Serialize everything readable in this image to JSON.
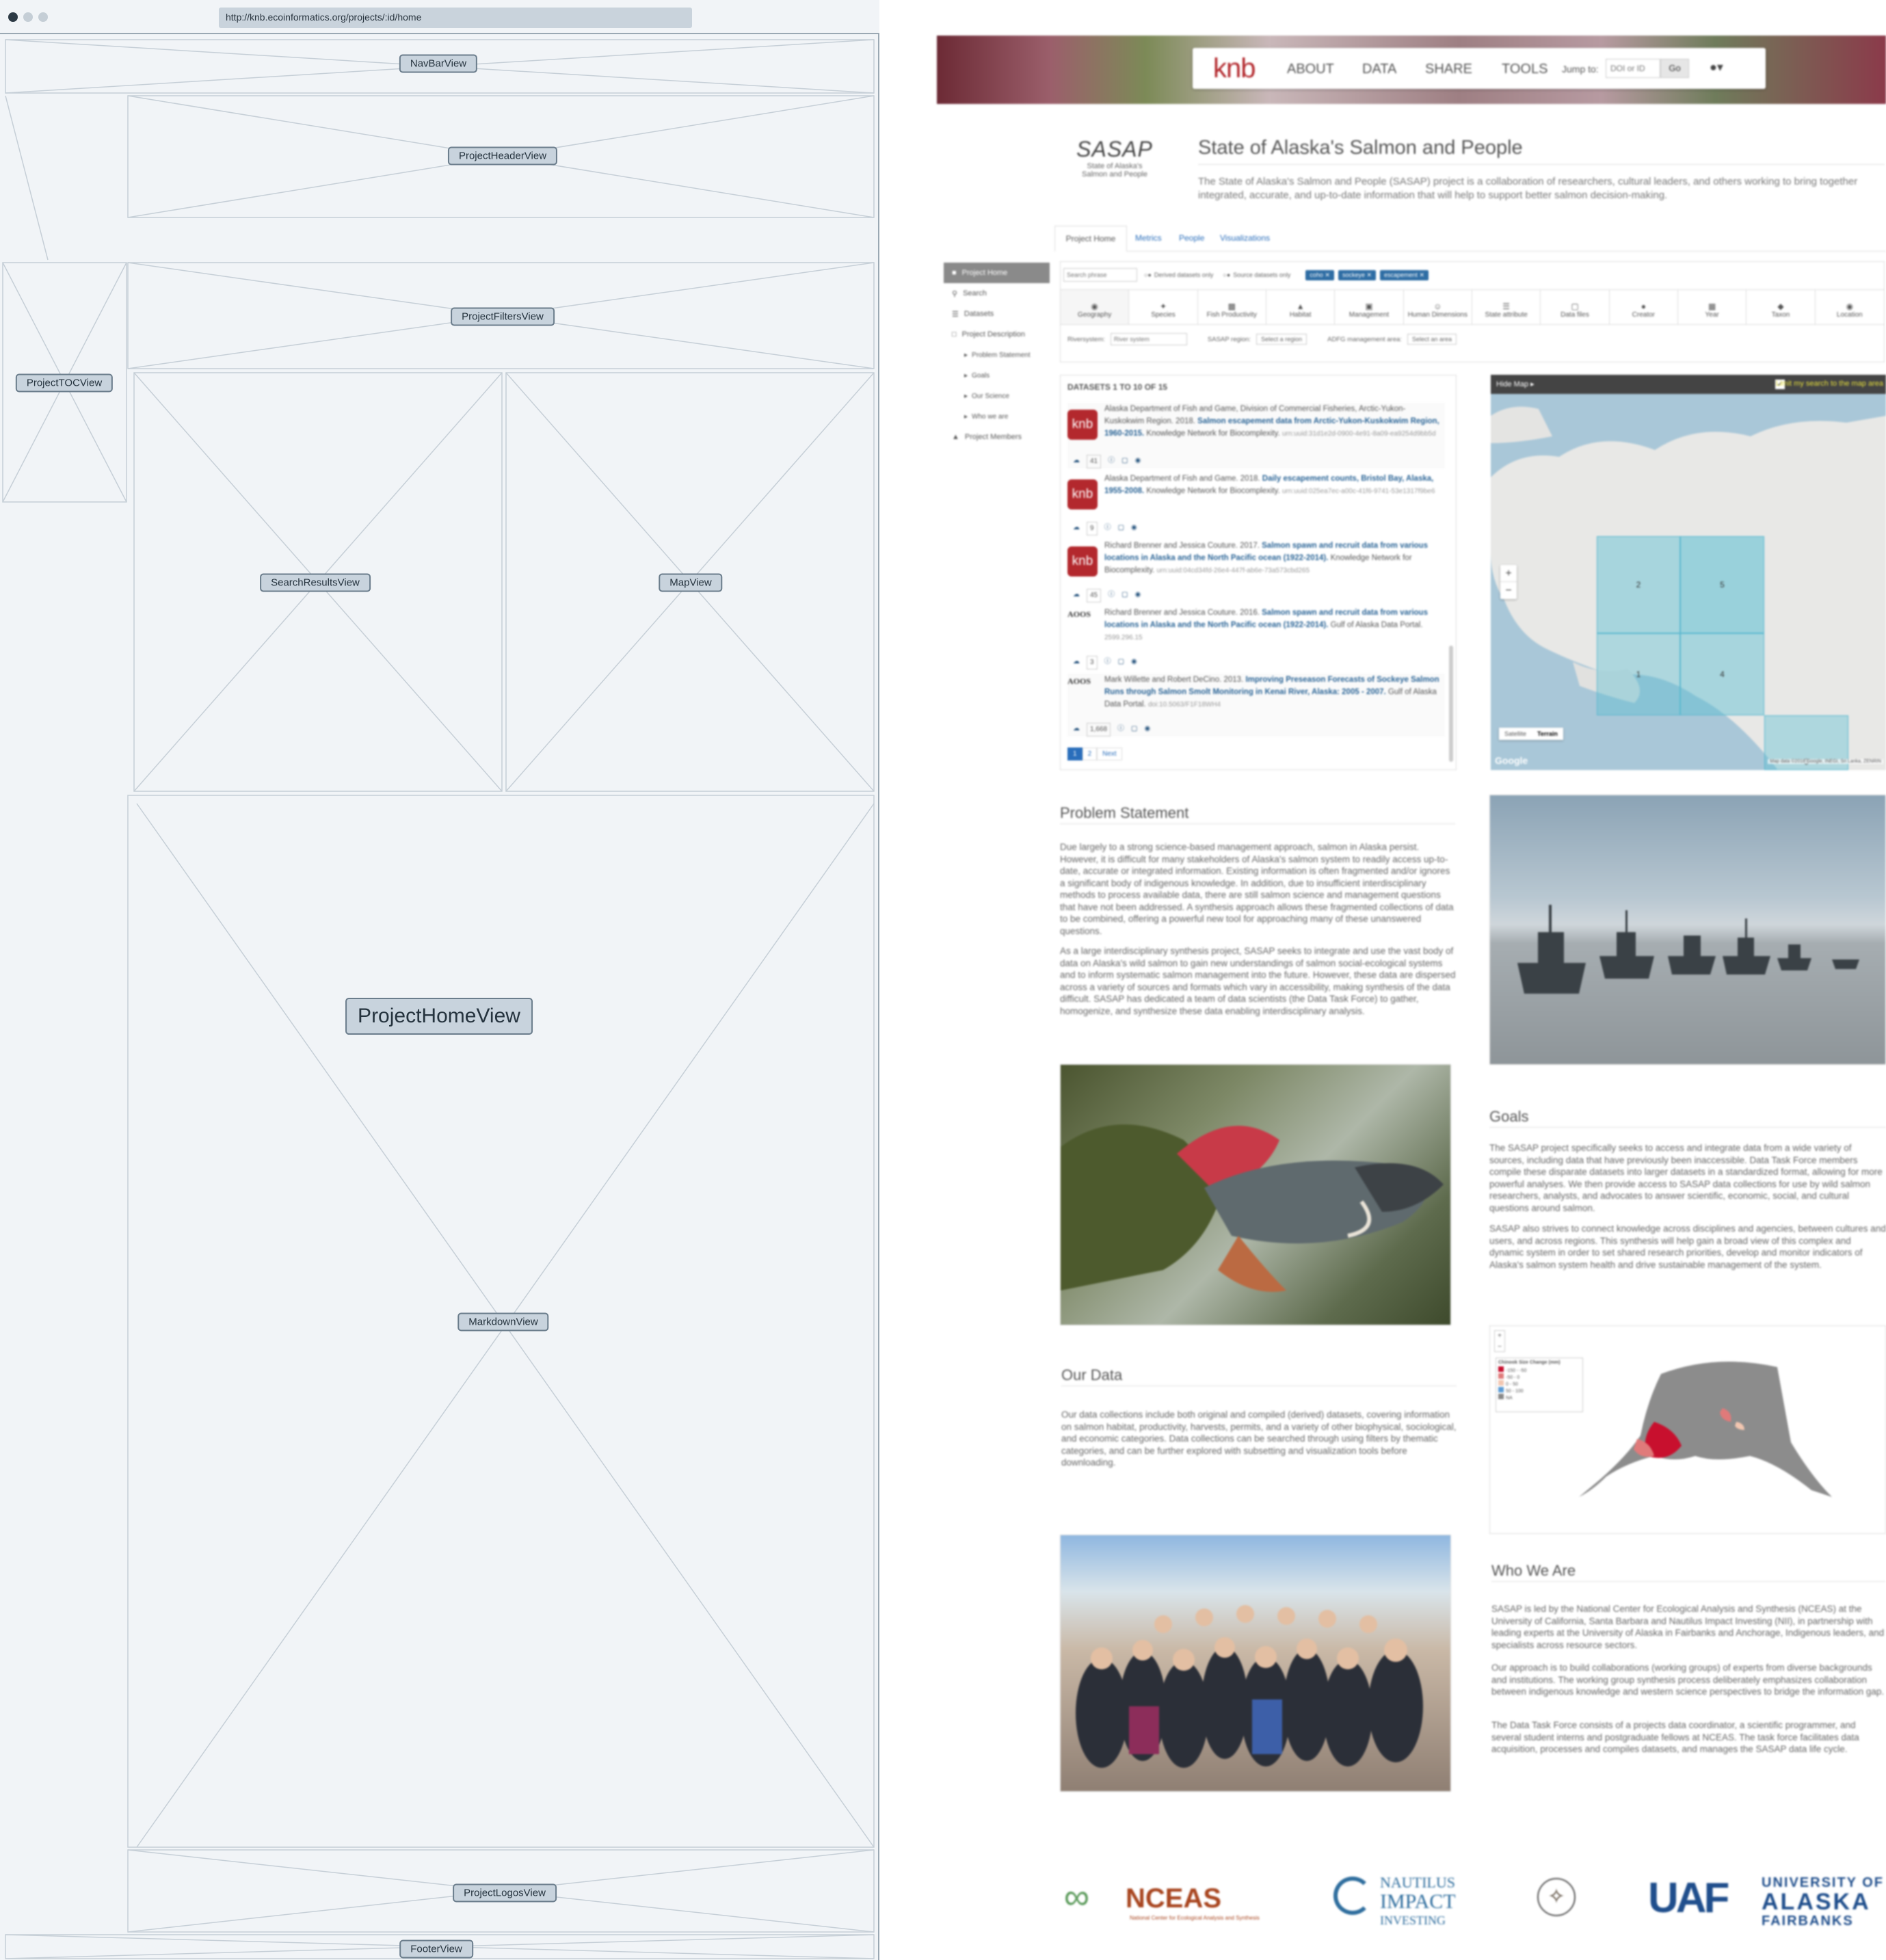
{
  "browser": {
    "url": "http://knb.ecoinformatics.org/projects/:id/home"
  },
  "wireframe": {
    "labels": {
      "navbar": "NavBarView",
      "header": "ProjectHeaderView",
      "filters": "ProjectFiltersView",
      "toc": "ProjectTOCView",
      "search": "SearchResultsView",
      "map": "MapView",
      "home": "ProjectHomeView",
      "markdown": "MarkdownView",
      "logos": "ProjectLogosView",
      "footer": "FooterView"
    }
  },
  "site": {
    "logo": "knb",
    "nav": [
      "ABOUT",
      "DATA",
      "SHARE",
      "TOOLS"
    ],
    "jump_label": "Jump to:",
    "jump_placeholder": "DOI or ID",
    "go": "Go"
  },
  "project": {
    "logo_text": "SASAP",
    "logo_sub1": "State of Alaska's",
    "logo_sub2": "Salmon and People",
    "title": "State of Alaska's Salmon and People",
    "description": "The State of Alaska's Salmon and People (SASAP) project is a collaboration of researchers, cultural leaders, and others working to bring together integrated, accurate, and up-to-date information that will help to support better salmon decision-making.",
    "tabs": [
      "Project Home",
      "Metrics",
      "People",
      "Visualizations"
    ]
  },
  "toc": [
    "Project Home",
    "Search",
    "Datasets",
    "Project Description",
    "Problem Statement",
    "Goals",
    "Our Science",
    "Who we are",
    "Project Members"
  ],
  "filters": {
    "search_placeholder": "Search phrase",
    "derived": "Derived datasets only",
    "source": "Source datasets only",
    "tags": [
      "coho",
      "sockeye",
      "escapement"
    ],
    "facets": [
      "Geography",
      "Species",
      "Fish Productivity",
      "Habitat",
      "Management",
      "Human Dimensions",
      "State attribute",
      "Data files",
      "Creator",
      "Year",
      "Taxon",
      "Location"
    ],
    "riversystem_label": "Riversystem:",
    "riversystem_placeholder": "River system",
    "region_label": "SASAP region:",
    "region_value": "Select a region",
    "adfg_label": "ADFG management area:",
    "adfg_value": "Select an area"
  },
  "results": {
    "header": "DATASETS 1 TO 10 OF 15",
    "items": [
      {
        "badge": "knb",
        "authors": "Alaska Department of Fish and Game, Division of Commercial Fisheries, Arctic-Yukon-Kuskokwim Region. 2018.",
        "title": "Salmon escapement data from Arctic-Yukon-Kuskokwim Region, 1960-2015.",
        "rest": "Knowledge Network for Biocomplexity.",
        "id": "urn:uuid:31d1e2d-0900-4e91-8a09-ea9254d9bb5d",
        "count": "41"
      },
      {
        "badge": "knb",
        "authors": "Alaska Department of Fish and Game. 2018.",
        "title": "Daily escapement counts, Bristol Bay, Alaska, 1955-2008.",
        "rest": "Knowledge Network for Biocomplexity.",
        "id": "urn:uuid:025ea7ec-a00c-41f6-9741-53e1317f9be6",
        "count": "9"
      },
      {
        "badge": "knb",
        "authors": "Richard Brenner and Jessica Couture. 2017.",
        "title": "Salmon spawn and recruit data from various locations in Alaska and the North Pacific ocean (1922-2014).",
        "rest": "Knowledge Network for Biocomplexity.",
        "id": "urn:uuid:04cd34fd-26e4-447f-ab6e-73a573cbd265",
        "count": "45"
      },
      {
        "badge": "AOOS",
        "authors": "Richard Brenner and Jessica Couture. 2016.",
        "title": "Salmon spawn and recruit data from various locations in Alaska and the North Pacific ocean (1922-2014).",
        "rest": "Gulf of Alaska Data Portal.",
        "id": "2599.296.15",
        "count": "3"
      },
      {
        "badge": "AOOS",
        "authors": "Mark Willette and Robert DeCino. 2013.",
        "title": "Improving Preseason Forecasts of Sockeye Salmon Runs through Salmon Smolt Monitoring in Kenai River, Alaska: 2005 - 2007.",
        "rest": "Gulf of Alaska Data Portal.",
        "id": "doi:10.5063/F1F18WH4",
        "count": "1,668"
      }
    ],
    "pages": [
      "1",
      "2",
      "Next"
    ]
  },
  "map": {
    "hide": "Hide Map",
    "limit": "Limit my search to the map area",
    "cells": [
      "2",
      "5",
      "1",
      "4",
      "3"
    ],
    "type_buttons": [
      "Satellite",
      "Terrain"
    ],
    "attribution": "Google",
    "credits": "Map data ©2018 Google, INEGI, Sri Lanka, ZENRIN"
  },
  "home": {
    "problem_title": "Problem Statement",
    "problem_p1": "Due largely to a strong science-based management approach, salmon in Alaska persist. However, it is difficult for many stakeholders of Alaska's salmon system to readily access up-to-date, accurate or integrated information. Existing information is often fragmented and/or ignores a significant body of indigenous knowledge. In addition, due to insufficient interdisciplinary methods to process available data, there are still salmon science and management questions that have not been addressed. A synthesis approach allows these fragmented collections of data to be combined, offering a powerful new tool for approaching many of these unanswered questions.",
    "problem_p2": "As a large interdisciplinary synthesis project, SASAP seeks to integrate and use the vast body of data on Alaska's wild salmon to gain new understandings of salmon social-ecological systems and to inform systematic salmon management into the future. However, these data are dispersed across a variety of sources and formats which vary in accessibility, making synthesis of the data difficult. SASAP has dedicated a team of data scientists (the Data Task Force) to gather, homogenize, and synthesize these data enabling interdisciplinary analysis.",
    "goals_title": "Goals",
    "goals_p1": "The SASAP project specifically seeks to access and integrate data from a wide variety of sources, including data that have previously been inaccessible. Data Task Force members compile these disparate datasets into larger datasets in a standardized format, allowing for more powerful analyses. We then provide access to SASAP data collections for use by wild salmon researchers, analysts, and advocates to answer scientific, economic, social, and cultural questions around salmon.",
    "goals_p2": "SASAP also strives to connect knowledge across disciplines and agencies, between cultures and users, and across regions. This synthesis will help gain a broad view of this complex and dynamic system in order to set shared research priorities, develop and monitor indicators of Alaska's salmon system health and drive sustainable management of the system.",
    "data_title": "Our Data",
    "data_p1": "Our data collections include both original and compiled (derived) datasets, covering information on salmon habitat, productivity, harvests, permits, and a variety of other biophysical, sociological, and economic categories. Data collections can be searched through using filters by thematic categories, and can be further explored with subsetting and visualization tools before downloading.",
    "who_title": "Who We Are",
    "who_p1": "SASAP is led by the National Center for Ecological Analysis and Synthesis (NCEAS) at the University of California, Santa Barbara and Nautilus Impact Investing (NII), in partnership with leading experts at the University of Alaska in Fairbanks and Anchorage, Indigenous leaders, and specialists across resource sectors.",
    "who_p2": "Our approach is to build collaborations (working groups) of experts from diverse backgrounds and institutions. The working group synthesis process deliberately emphasizes collaboration between indigenous knowledge and western science perspectives to bridge the information gap.",
    "who_p3": "The Data Task Force consists of a projects data coordinator, a scientific programmer, and several student interns and postgraduate fellows at NCEAS. The task force facilitates data acquisition, processes and compiles datasets, and manages the SASAP data life cycle.",
    "legend_title": "Chinook Size Change (mm)",
    "legend": [
      "-150 - -50",
      "-50 - 0",
      "0 - 50",
      "50 - 100",
      "NA"
    ]
  },
  "logos": {
    "nceas": "NCEAS",
    "nceas_sub": "National Center for Ecological Analysis and Synthesis",
    "nautilus1": "NAUTILUS",
    "nautilus2": "IMPACT",
    "nautilus3": "INVESTING",
    "uaf_mark": "UAF",
    "uaf1": "UNIVERSITY OF",
    "uaf2": "ALASKA",
    "uaf3": "FAIRBANKS"
  }
}
